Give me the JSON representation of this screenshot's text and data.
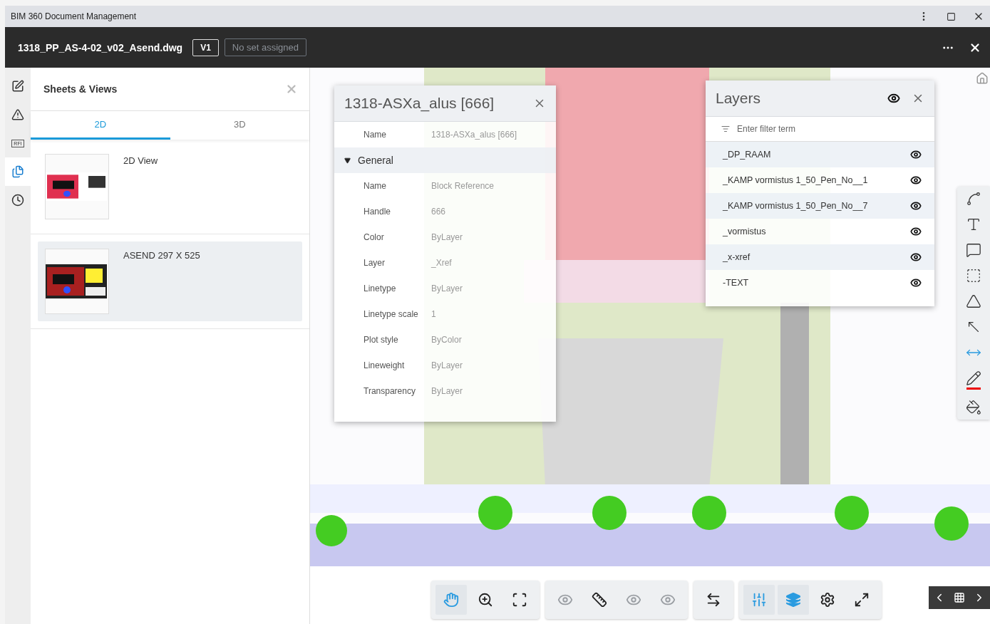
{
  "window": {
    "title": "BIM 360 Document Management"
  },
  "header": {
    "file_name": "1318_PP_AS-4-02_v02_Asend.dwg",
    "version": "V1",
    "set_badge": "No set assigned"
  },
  "rail": [
    {
      "selected": false
    },
    {
      "selected": false
    },
    {
      "label": "RFI",
      "selected": false
    },
    {
      "selected": true
    },
    {
      "selected": false
    }
  ],
  "sheets_panel": {
    "title": "Sheets & Views",
    "tabs": [
      {
        "label": "2D",
        "selected": true
      },
      {
        "label": "3D",
        "selected": false
      }
    ],
    "items": [
      {
        "label": "2D View",
        "selected": false
      },
      {
        "label": "ASEND 297 X 525",
        "selected": true
      }
    ]
  },
  "properties_panel": {
    "title": "1318-ASXa_alus [666]",
    "top_rows": [
      {
        "name": "Name",
        "value": "1318-ASXa_alus [666]"
      }
    ],
    "groups": [
      {
        "label": "General",
        "expanded": true,
        "rows": [
          {
            "name": "Name",
            "value": "Block Reference"
          },
          {
            "name": "Handle",
            "value": "666"
          },
          {
            "name": "Color",
            "value": "ByLayer"
          },
          {
            "name": "Layer",
            "value": "_Xref"
          },
          {
            "name": "Linetype",
            "value": "ByLayer"
          },
          {
            "name": "Linetype scale",
            "value": "1"
          },
          {
            "name": "Plot style",
            "value": "ByColor"
          },
          {
            "name": "Lineweight",
            "value": "ByLayer"
          },
          {
            "name": "Transparency",
            "value": "ByLayer"
          }
        ]
      }
    ]
  },
  "layers_panel": {
    "title": "Layers",
    "filter_placeholder": "Enter filter term",
    "layers": [
      {
        "name": "_DP_RAAM",
        "visible": true
      },
      {
        "name": "_KAMP vormistus 1_50_Pen_No__1",
        "visible": true
      },
      {
        "name": "_KAMP vormistus 1_50_Pen_No__7",
        "visible": true
      },
      {
        "name": "_vormistus",
        "visible": true
      },
      {
        "name": "_x-xref",
        "visible": true
      },
      {
        "name": "-TEXT",
        "visible": true
      }
    ]
  },
  "toolbar": [
    [
      {
        "selected": true,
        "disabled": false
      },
      {
        "selected": false,
        "disabled": false
      },
      {
        "selected": false,
        "disabled": false
      }
    ],
    [
      {
        "selected": false,
        "disabled": true
      },
      {
        "selected": false,
        "disabled": false
      },
      {
        "selected": false,
        "disabled": true
      },
      {
        "selected": false,
        "disabled": true
      }
    ],
    [
      {
        "selected": false,
        "disabled": false
      }
    ],
    [
      {
        "selected": true,
        "disabled": false
      },
      {
        "selected": true,
        "disabled": false
      },
      {
        "selected": false,
        "disabled": false
      },
      {
        "selected": false,
        "disabled": false
      }
    ]
  ]
}
